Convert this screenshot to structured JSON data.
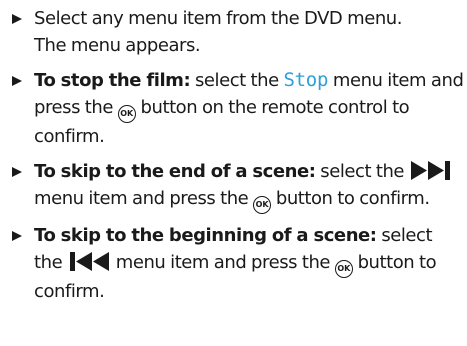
{
  "steps": [
    {
      "line1": "Select any menu item from the DVD menu.",
      "line2": "The menu appears."
    },
    {
      "lead": "To stop the film:",
      "pre": " select the ",
      "menu_item": "Stop",
      "post1": " menu item and press the ",
      "ok_label": "OK",
      "post2": " button on the remote control to confirm."
    },
    {
      "lead": "To skip to the end of a scene:",
      "pre": " select the ",
      "icon": "skip-forward-icon",
      "post1": " menu item and press the ",
      "ok_label": "OK",
      "post2": " button to confirm."
    },
    {
      "lead": "To skip to the beginning of a scene:",
      "pre": " select the ",
      "icon": "skip-back-icon",
      "post1": " menu item and press the ",
      "ok_label": "OK",
      "post2": " button to confirm."
    }
  ],
  "colors": {
    "text": "#1a1a1a",
    "menu_item": "#2f9fd9"
  }
}
